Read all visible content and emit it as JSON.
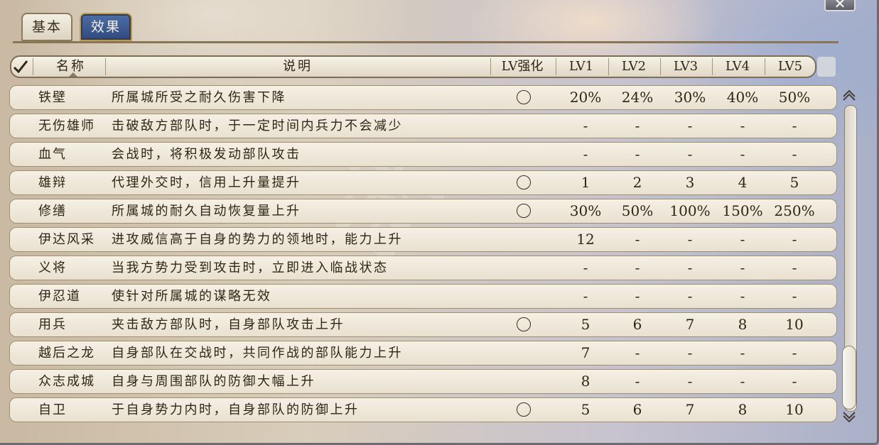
{
  "window": {
    "close_label": "✕"
  },
  "tabs": [
    {
      "label": "基本",
      "active": false
    },
    {
      "label": "效果",
      "active": true
    }
  ],
  "header": {
    "check_icon": "checkmark-icon",
    "name": "名称",
    "desc": "说明",
    "lv_boost": "LV强化",
    "lv1": "LV1",
    "lv2": "LV2",
    "lv3": "LV3",
    "lv4": "LV4",
    "lv5": "LV5"
  },
  "rows": [
    {
      "name": "铁壁",
      "desc": "所属城所受之耐久伤害下降",
      "boost": true,
      "v": [
        "20%",
        "24%",
        "30%",
        "40%",
        "50%"
      ]
    },
    {
      "name": "无伤雄师",
      "desc": "击破敌方部队时，于一定时间内兵力不会减少",
      "boost": false,
      "v": [
        "-",
        "-",
        "-",
        "-",
        "-"
      ]
    },
    {
      "name": "血气",
      "desc": "会战时，将积极发动部队攻击",
      "boost": false,
      "v": [
        "-",
        "-",
        "-",
        "-",
        "-"
      ]
    },
    {
      "name": "雄辩",
      "desc": "代理外交时，信用上升量提升",
      "boost": true,
      "v": [
        "1",
        "2",
        "3",
        "4",
        "5"
      ]
    },
    {
      "name": "修缮",
      "desc": "所属城的耐久自动恢复量上升",
      "boost": true,
      "v": [
        "30%",
        "50%",
        "100%",
        "150%",
        "250%"
      ]
    },
    {
      "name": "伊达风采",
      "desc": "进攻威信高于自身的势力的领地时，能力上升",
      "boost": false,
      "v": [
        "12",
        "-",
        "-",
        "-",
        "-"
      ]
    },
    {
      "name": "义将",
      "desc": "当我方势力受到攻击时，立即进入临战状态",
      "boost": false,
      "v": [
        "-",
        "-",
        "-",
        "-",
        "-"
      ]
    },
    {
      "name": "伊忍道",
      "desc": "使针对所属城的谋略无效",
      "boost": false,
      "v": [
        "-",
        "-",
        "-",
        "-",
        "-"
      ]
    },
    {
      "name": "用兵",
      "desc": "夹击敌方部队时，自身部队攻击上升",
      "boost": true,
      "v": [
        "5",
        "6",
        "7",
        "8",
        "10"
      ]
    },
    {
      "name": "越后之龙",
      "desc": "自身部队在交战时，共同作战的部队能力上升",
      "boost": false,
      "v": [
        "7",
        "-",
        "-",
        "-",
        "-"
      ]
    },
    {
      "name": "众志成城",
      "desc": "自身与周围部队的防御大幅上升",
      "boost": false,
      "v": [
        "8",
        "-",
        "-",
        "-",
        "-"
      ]
    },
    {
      "name": "自卫",
      "desc": "于自身势力内时，自身部队的防御上升",
      "boost": true,
      "v": [
        "5",
        "6",
        "7",
        "8",
        "10"
      ]
    }
  ],
  "colors": {
    "tab_active": "#2f4a80",
    "row_bg": "#f5f0e4",
    "border": "#7d6d55",
    "text": "#2f2516"
  }
}
